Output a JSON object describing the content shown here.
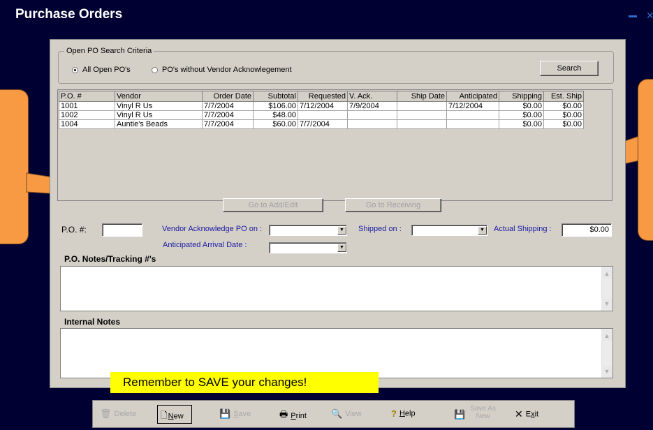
{
  "window": {
    "title": "Purchase Orders"
  },
  "criteria": {
    "legend": "Open PO Search Criteria",
    "options": [
      "All Open PO's",
      "PO's without Vendor Acknowlegement"
    ],
    "selected_index": 0,
    "search_label": "Search"
  },
  "table": {
    "columns": [
      "P.O. #",
      "Vendor",
      "Order Date",
      "Subtotal",
      "Requested",
      "V. Ack.",
      "Ship Date",
      "Anticipated",
      "Shipping",
      "Est. Ship"
    ],
    "rows": [
      [
        "1001",
        "Vinyl R Us",
        "7/7/2004",
        "$106.00",
        "7/12/2004",
        "7/9/2004",
        "",
        "7/12/2004",
        "$0.00",
        "$0.00"
      ],
      [
        "1002",
        "Vinyl R Us",
        "7/7/2004",
        "$48.00",
        "",
        "",
        "",
        "",
        "$0.00",
        "$0.00"
      ],
      [
        "1004",
        "Auntie's Beads",
        "7/7/2004",
        "$60.00",
        "7/7/2004",
        "",
        "",
        "",
        "$0.00",
        "$0.00"
      ]
    ]
  },
  "goto": {
    "add_edit": "Go to Add/Edit",
    "receiving": "Go to Receiving"
  },
  "form": {
    "po_label": "P.O. #:",
    "po_value": "",
    "vendor_ack_label": "Vendor Acknowledge PO on :",
    "shipped_label": "Shipped on :",
    "actual_shipping_label": "Actual Shipping :",
    "actual_shipping_value": "$0.00",
    "anticipated_label": "Anticipated Arrival Date :"
  },
  "notes": {
    "tracking_label": "P.O. Notes/Tracking #'s",
    "internal_label": "Internal Notes"
  },
  "reminder": "Remember to SAVE your changes!",
  "toolbar": {
    "delete": "Delete",
    "new": "New",
    "save": "Save",
    "print": "Print",
    "view": "View",
    "help": "Help",
    "save_as_new_1": "Save As",
    "save_as_new_2": "New",
    "exit": "Exit"
  },
  "colors": {
    "background": "#000033",
    "panel": "#d4d0c8",
    "callout": "#f79a43",
    "reminder": "#ffff00",
    "link_label": "#1a1aa0"
  }
}
